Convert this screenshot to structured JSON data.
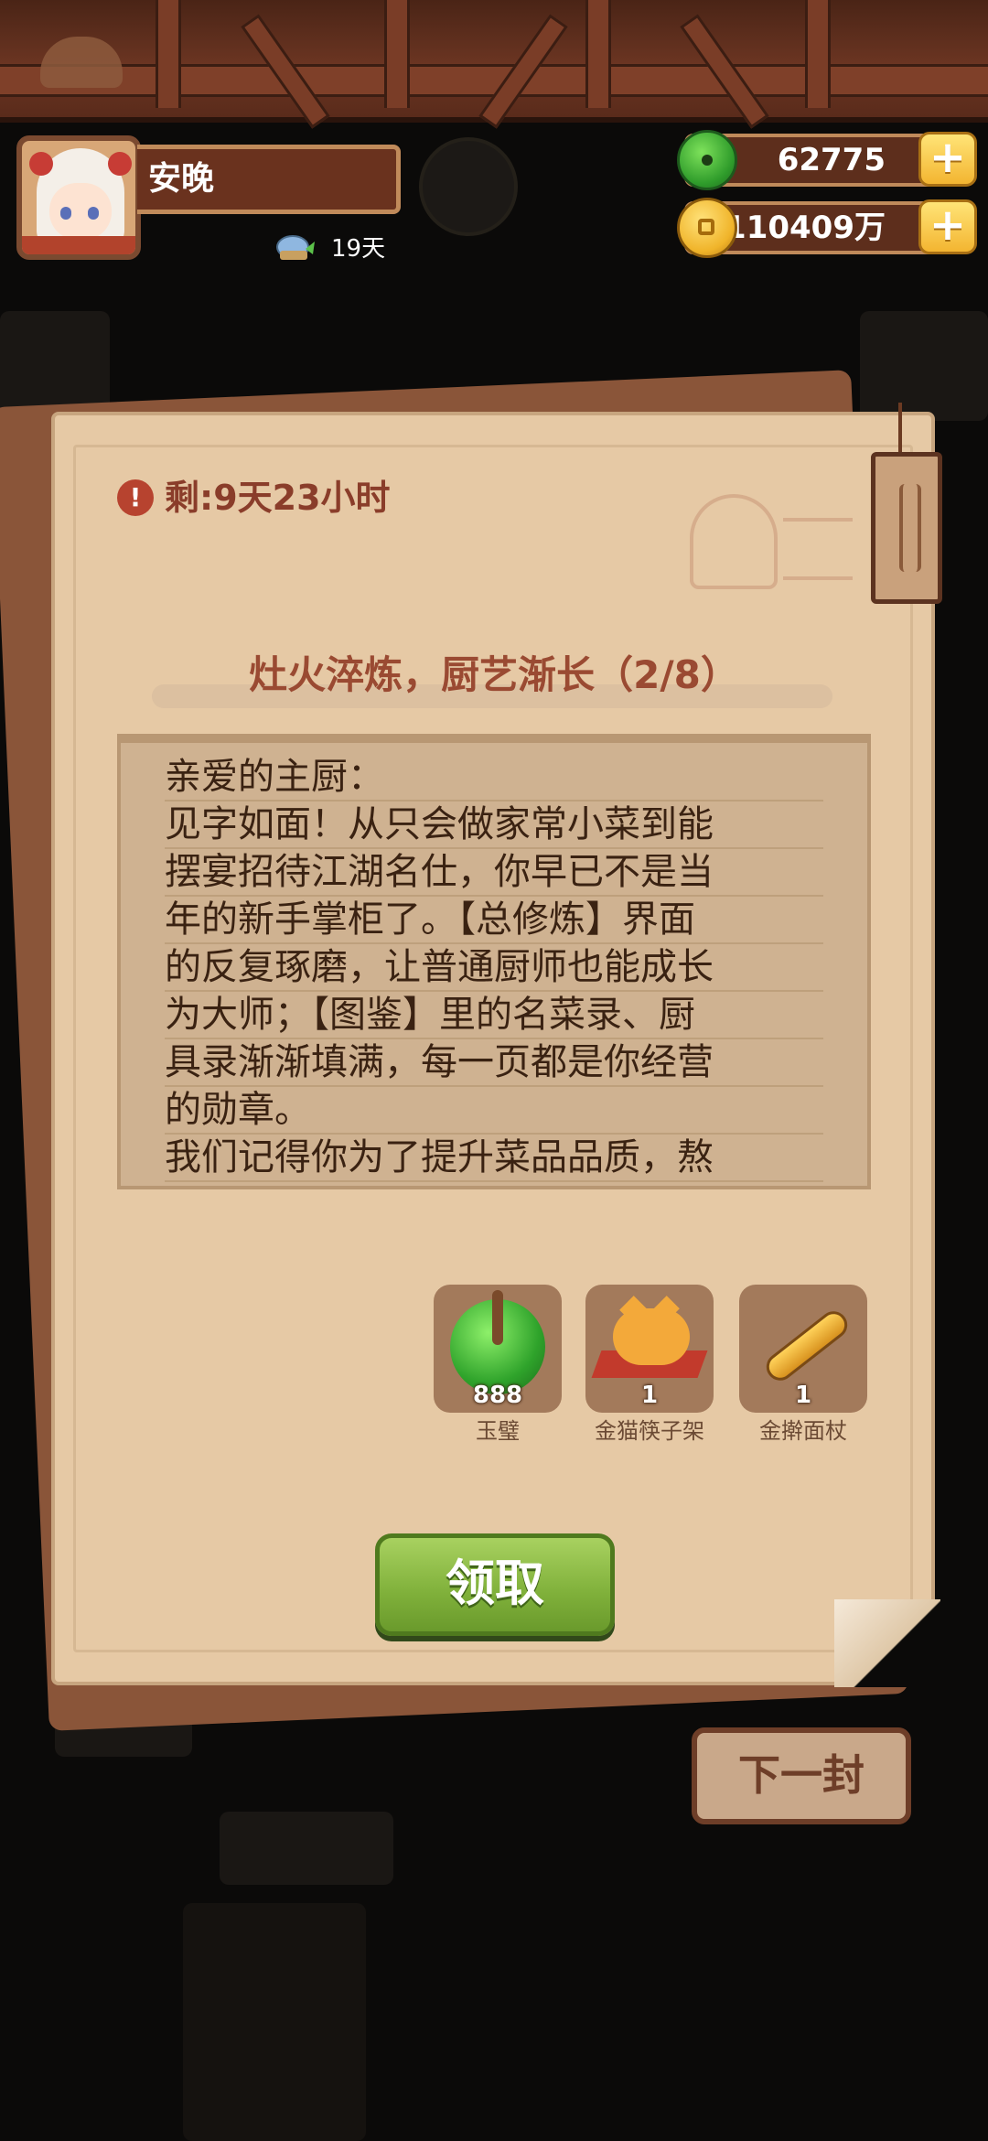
{
  "player": {
    "name": "安晚",
    "days": "19天"
  },
  "currency": {
    "jade": "62775",
    "coins": "110409万"
  },
  "letter": {
    "timer": "剩:9天23小时",
    "title": "灶火淬炼，厨艺渐长（2/8）",
    "body_lines": [
      "亲爱的主厨：",
      "见字如面！从只会做家常小菜到能",
      "摆宴招待江湖名仕，你早已不是当",
      "年的新手掌柜了。【总修炼】界面",
      "的反复琢磨，让普通厨师也能成长",
      "为大师；【图鉴】里的名菜录、厨",
      "具录渐渐填满，每一页都是你经营",
      "的勋章。",
      "我们记得你为了提升菜品品质，熬"
    ]
  },
  "rewards": [
    {
      "name": "玉璧",
      "count": "888",
      "icon": "jade-disc-icon"
    },
    {
      "name": "金猫筷子架",
      "count": "1",
      "icon": "gold-cat-chopstick-rest-icon"
    },
    {
      "name": "金擀面杖",
      "count": "1",
      "icon": "gold-rolling-pin-icon"
    }
  ],
  "buttons": {
    "claim": "领取",
    "next": "下一封"
  },
  "colors": {
    "paper": "#e6c9a5",
    "title_red": "#9a4a32",
    "claim_green": "#7fb03a",
    "wood_brown": "#6b3522"
  }
}
